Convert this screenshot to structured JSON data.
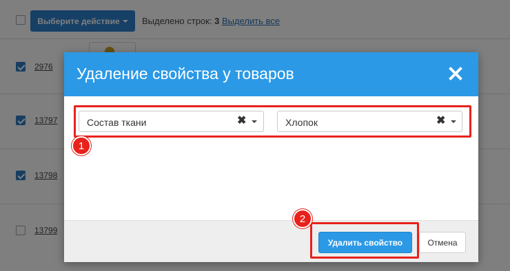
{
  "toolbar": {
    "action_label": "Выберите действие",
    "selected_prefix": "Выделено строк:",
    "selected_count": "3",
    "select_all_label": "Выделить все"
  },
  "rows": [
    {
      "id": "2976",
      "checked": true
    },
    {
      "id": "13797",
      "checked": true
    },
    {
      "id": "13798",
      "checked": true
    },
    {
      "id": "13799",
      "checked": false
    }
  ],
  "modal": {
    "title": "Удаление свойства у товаров",
    "property_select": {
      "value": "Состав ткани"
    },
    "value_select": {
      "value": "Хлопок"
    },
    "delete_label": "Удалить свойство",
    "cancel_label": "Отмена"
  },
  "annotations": {
    "step1": "1",
    "step2": "2",
    "color": "#e8211c"
  },
  "colors": {
    "accent": "#2b99e6",
    "action_button": "#2f80cc"
  },
  "icons": [
    "close-icon",
    "clear-icon",
    "chevron-down-icon",
    "checkbox-icon"
  ]
}
